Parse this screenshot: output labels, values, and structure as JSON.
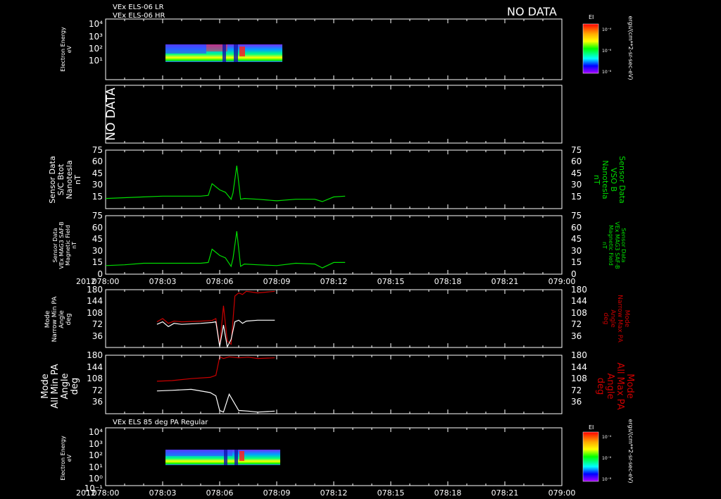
{
  "header": {
    "line1": "VEx ELS-06 LR",
    "line2": "VEx ELS-06 HR",
    "no_data": "NO DATA"
  },
  "colorbar": {
    "label": "EI",
    "tick_labels": [
      "10⁻⁴",
      "10⁻⁶",
      "10⁻⁸"
    ],
    "unit_label": "ergs/(cm**2-sr-sec-eV)"
  },
  "time_axis": {
    "year": "2012",
    "tick_labels": [
      "078:00",
      "078:03",
      "078:06",
      "078:09",
      "078:12",
      "078:15",
      "078:18",
      "078:21",
      "079:00"
    ]
  },
  "panel1": {
    "ylabel_line1": "Electron Energy",
    "ylabel_line2": "eV",
    "tick_labels": [
      "10⁴",
      "10³",
      "10²",
      "10¹"
    ]
  },
  "panel2": {
    "no_data": "NO DATA"
  },
  "panel3": {
    "left_label": [
      "Sensor Data",
      "S/C Btot",
      "Nanotesla",
      "nT"
    ],
    "right_label": [
      "Sensor Data",
      "VSO B",
      "Nanotesla",
      "nT"
    ],
    "tick_labels": [
      "75",
      "60",
      "45",
      "30",
      "15"
    ]
  },
  "panel4": {
    "left_label": [
      "Sensor Data",
      "VEx MAG3 SAF-B",
      "Magnetic Field",
      "nT"
    ],
    "right_label": [
      "Sensor Data",
      "VEx MAG3 SAF-B",
      "Magnetic Field",
      "nT"
    ],
    "tick_labels": [
      "75",
      "60",
      "45",
      "30",
      "15",
      "0"
    ]
  },
  "panel5": {
    "left_label": [
      "Mode",
      "Narrow Min PA",
      "Angle",
      "deg"
    ],
    "right_label": [
      "Mode",
      "Narrow Max PA",
      "Angle",
      "deg"
    ],
    "tick_labels": [
      "180",
      "144",
      "108",
      "72",
      "36"
    ]
  },
  "panel6": {
    "left_label": [
      "Mode",
      "All Min PA",
      "Angle",
      "deg"
    ],
    "right_label": [
      "Mode",
      "All Max PA",
      "Angle",
      "deg"
    ],
    "tick_labels": [
      "180",
      "144",
      "108",
      "72",
      "36"
    ]
  },
  "panel7": {
    "title": "VEx ELS 85 deg PA Regular",
    "ylabel_line1": "Electron Energy",
    "ylabel_line2": "eV",
    "tick_labels": [
      "10⁴",
      "10³",
      "10²",
      "10¹",
      "10⁰",
      "10⁻¹"
    ]
  },
  "chart_data": [
    {
      "type": "heatmap",
      "name": "panel1",
      "x_range_min": [
        0,
        24
      ],
      "data_x_range_min": [
        2.7,
        8.9
      ],
      "ylim_log10": [
        0,
        4
      ],
      "y_data_range_log10": [
        0.9,
        2.3
      ],
      "scale": "log"
    },
    {
      "type": "line",
      "name": "panel3",
      "ylim": [
        0,
        75
      ],
      "x_min": [
        0,
        1,
        2,
        3,
        4,
        5,
        5.4,
        5.6,
        6.0,
        6.3,
        6.6,
        6.7,
        6.9,
        7.1,
        7.3,
        8.0,
        9.0,
        10.0,
        11.0,
        11.4,
        12.0,
        12.6
      ],
      "y": [
        13,
        14,
        15,
        16,
        16,
        16,
        17,
        32,
        24,
        21,
        12,
        20,
        55,
        12,
        13,
        12,
        10,
        12,
        12,
        9,
        15,
        16
      ],
      "color": "#00dd00"
    },
    {
      "type": "line",
      "name": "panel4",
      "ylim": [
        0,
        75
      ],
      "x_min": [
        0,
        1,
        2,
        3,
        4,
        5,
        5.4,
        5.6,
        6.0,
        6.3,
        6.6,
        6.7,
        6.9,
        7.1,
        7.3,
        8.0,
        9.0,
        10.0,
        11.0,
        11.4,
        12.0,
        12.6
      ],
      "y": [
        11,
        12,
        14,
        14,
        14,
        14,
        15,
        32,
        24,
        21,
        10,
        20,
        55,
        10,
        13,
        12,
        11,
        14,
        13,
        8,
        15,
        15
      ],
      "color": "#00dd00"
    },
    {
      "type": "line",
      "name": "panel5",
      "ylim": [
        0,
        180
      ],
      "series": [
        {
          "x_min": [
            2.7,
            3.0,
            3.3,
            3.6,
            4.0,
            5.0,
            5.6,
            5.8,
            6.0,
            6.2,
            6.4,
            6.6,
            6.8,
            7.0,
            7.2,
            7.4,
            8.0,
            8.9
          ],
          "y": [
            80,
            90,
            75,
            82,
            80,
            82,
            84,
            90,
            5,
            130,
            20,
            10,
            160,
            170,
            165,
            175,
            170,
            175
          ],
          "color": "#cc0000"
        },
        {
          "x_min": [
            2.7,
            3.0,
            3.3,
            3.6,
            4.0,
            5.0,
            5.6,
            5.8,
            6.0,
            6.2,
            6.4,
            6.6,
            6.8,
            7.0,
            7.2,
            7.4,
            8.0,
            8.9
          ],
          "y": [
            72,
            80,
            65,
            75,
            72,
            75,
            78,
            80,
            3,
            70,
            2,
            25,
            80,
            85,
            75,
            82,
            85,
            85
          ],
          "color": "#ffffff"
        }
      ]
    },
    {
      "type": "line",
      "name": "panel6",
      "ylim": [
        0,
        180
      ],
      "series": [
        {
          "x_min": [
            2.7,
            3.5,
            4.5,
            5.5,
            5.8,
            6.0,
            6.2,
            6.5,
            7.0,
            7.5,
            8.0,
            8.9
          ],
          "y": [
            100,
            102,
            108,
            112,
            118,
            175,
            170,
            175,
            172,
            174,
            170,
            172
          ],
          "color": "#cc0000"
        },
        {
          "x_min": [
            2.7,
            3.5,
            4.5,
            5.5,
            5.8,
            6.0,
            6.2,
            6.5,
            7.0,
            7.5,
            8.0,
            8.9
          ],
          "y": [
            70,
            72,
            75,
            65,
            55,
            10,
            5,
            60,
            10,
            8,
            5,
            8
          ],
          "color": "#ffffff"
        }
      ]
    },
    {
      "type": "heatmap",
      "name": "panel7",
      "ylim_log10": [
        -1,
        4
      ],
      "data_x_range_min": [
        2.7,
        8.9
      ],
      "y_data_range_log10": [
        0.6,
        2.2
      ],
      "scale": "log"
    }
  ]
}
